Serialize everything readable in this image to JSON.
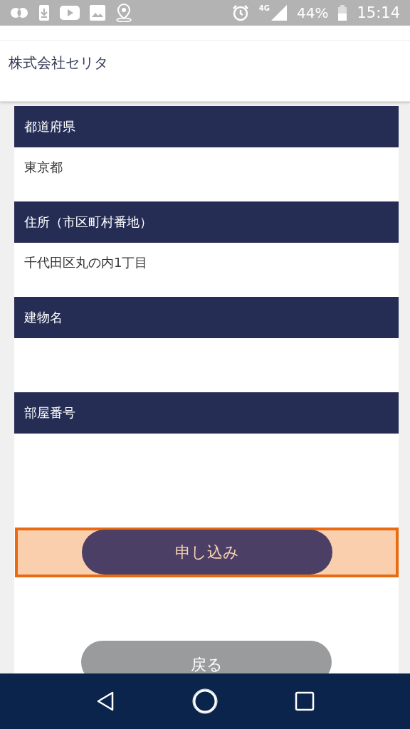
{
  "status_bar": {
    "battery": "44%",
    "time": "15:14",
    "network": "4G"
  },
  "header": {
    "company": "株式会社セリタ"
  },
  "fields": [
    {
      "label": "都道府県",
      "value": "東京都"
    },
    {
      "label": "住所（市区町村番地）",
      "value": "千代田区丸の内1丁目"
    },
    {
      "label": "建物名"
    },
    {
      "label": "部屋番号"
    }
  ],
  "submit_button": {
    "label": "申し込み",
    "highlighted": true
  },
  "back_button": {
    "label": "戻る"
  }
}
